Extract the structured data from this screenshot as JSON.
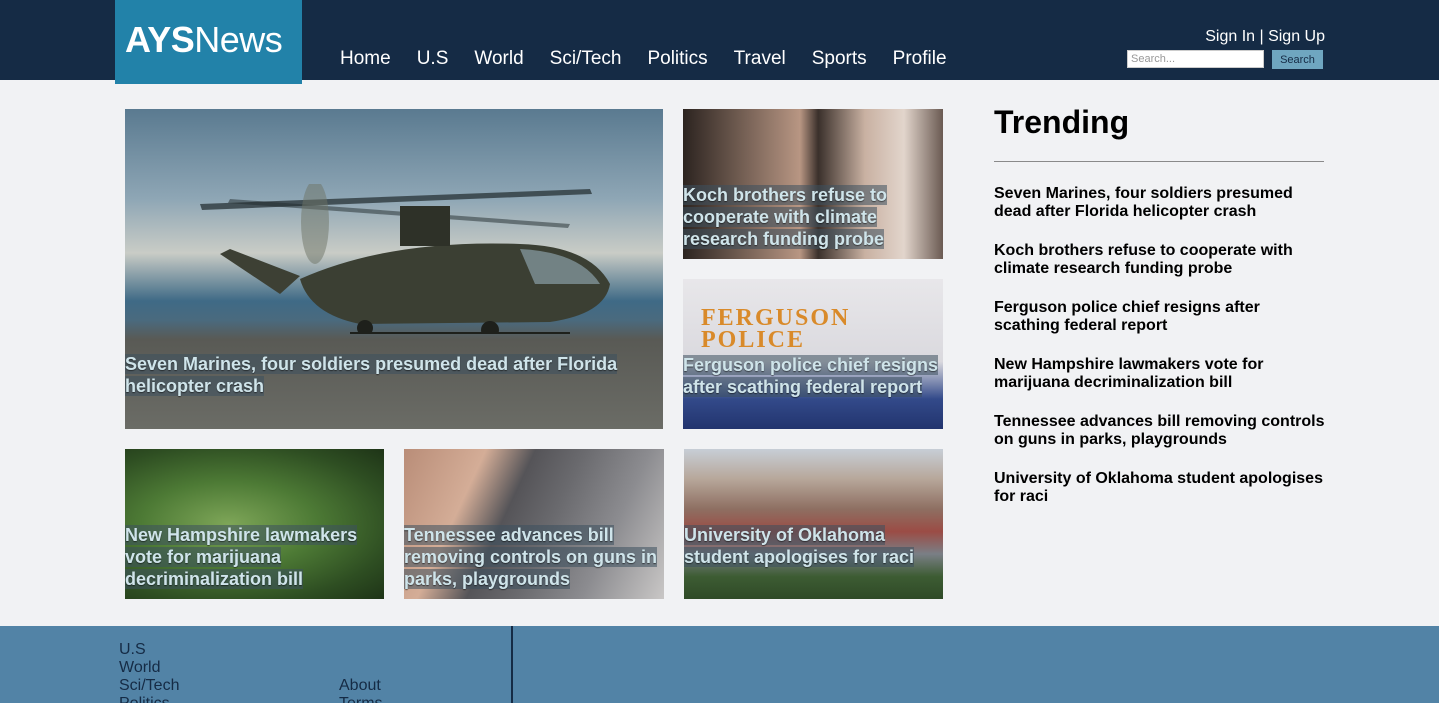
{
  "header": {
    "logo": {
      "strong": "AYS",
      "rest": "News"
    },
    "nav": [
      "Home",
      "U.S",
      "World",
      "Sci/Tech",
      "Politics",
      "Travel",
      "Sports",
      "Profile"
    ],
    "auth": {
      "sign_in": "Sign In",
      "separator": " | ",
      "sign_up": "Sign Up"
    },
    "search": {
      "placeholder": "Search...",
      "button": "Search"
    }
  },
  "stories": [
    {
      "headline": "Seven Marines, four soldiers presumed dead after Florida helicopter crash"
    },
    {
      "headline": "Koch brothers refuse to cooperate with climate research funding probe"
    },
    {
      "headline": "Ferguson police chief resigns after scathing federal report",
      "image_sign": "FERGUSON POLICE"
    },
    {
      "headline": "New Hampshire lawmakers vote for marijuana decriminalization bill"
    },
    {
      "headline": "Tennessee advances bill removing controls on guns in parks, playgrounds"
    },
    {
      "headline": "University of Oklahoma student apologises for raci"
    }
  ],
  "trending": {
    "title": "Trending",
    "items": [
      "Seven Marines, four soldiers presumed dead after Florida helicopter crash",
      "Koch brothers refuse to cooperate with climate research funding probe",
      "Ferguson police chief resigns after scathing federal report",
      "New Hampshire lawmakers vote for marijuana decriminalization bill",
      "Tennessee advances bill removing controls on guns in parks, playgrounds",
      "University of Oklahoma student apologises for raci"
    ]
  },
  "footer": {
    "col1": [
      "U.S",
      "World",
      "Sci/Tech",
      "Politics"
    ],
    "col2": [
      "About",
      "Terms"
    ]
  },
  "colors": {
    "header_bg": "#152b45",
    "logo_bg": "#2282a9",
    "footer_bg": "#5283a6",
    "page_bg": "#f1f2f4"
  }
}
